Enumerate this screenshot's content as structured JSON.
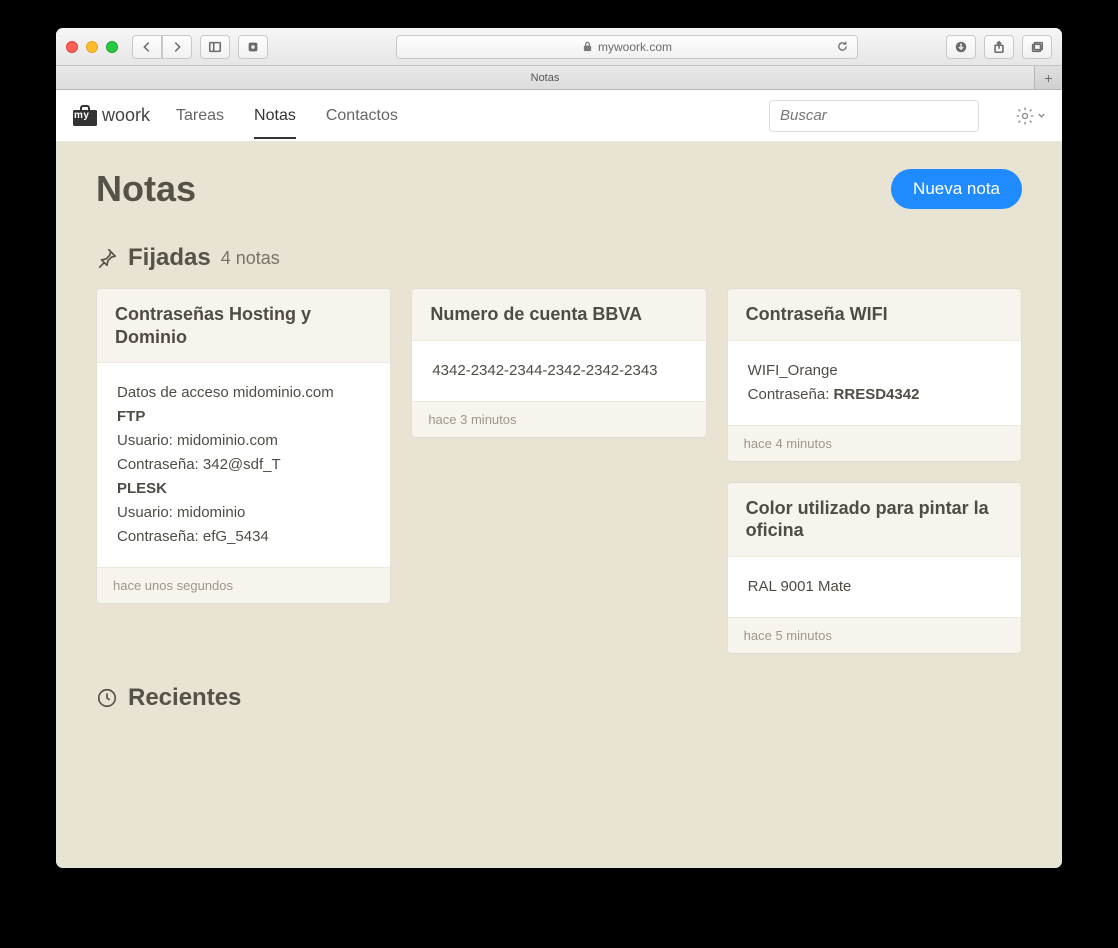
{
  "browser": {
    "url": "mywoork.com",
    "tab_title": "Notas"
  },
  "nav": {
    "brand_prefix": "my",
    "brand_text": "woork",
    "links": [
      "Tareas",
      "Notas",
      "Contactos"
    ],
    "active_index": 1,
    "search_placeholder": "Buscar"
  },
  "page": {
    "title": "Notas",
    "new_button": "Nueva nota"
  },
  "pinned": {
    "label": "Fijadas",
    "count_label": "4 notas"
  },
  "recent": {
    "label": "Recientes"
  },
  "cards": [
    {
      "title": "Contraseñas Hosting y Dominio",
      "body_lines": [
        {
          "text": "Datos de acceso midominio.com"
        },
        {
          "text": "FTP",
          "bold": true
        },
        {
          "text": "Usuario: midominio.com"
        },
        {
          "text": "Contraseña: 342@sdf_T"
        },
        {
          "text": "PLESK",
          "bold": true
        },
        {
          "text": "Usuario: midominio"
        },
        {
          "text": "Contraseña: efG_5434"
        }
      ],
      "footer": "hace unos segundos"
    },
    {
      "title": "Numero de cuenta BBVA",
      "body_lines": [
        {
          "text": "4342-2342-2344-2342-2342-2343"
        }
      ],
      "footer": "hace 3 minutos"
    },
    {
      "title": "Contraseña WIFI",
      "body_lines": [
        {
          "text": "WIFI_Orange"
        },
        {
          "label": "Contraseña: ",
          "strong": "RRESD4342"
        }
      ],
      "footer": "hace 4 minutos"
    },
    {
      "title": "Color utilizado para pintar la oficina",
      "body_lines": [
        {
          "text": "RAL 9001 Mate"
        }
      ],
      "footer": "hace 5 minutos"
    }
  ]
}
